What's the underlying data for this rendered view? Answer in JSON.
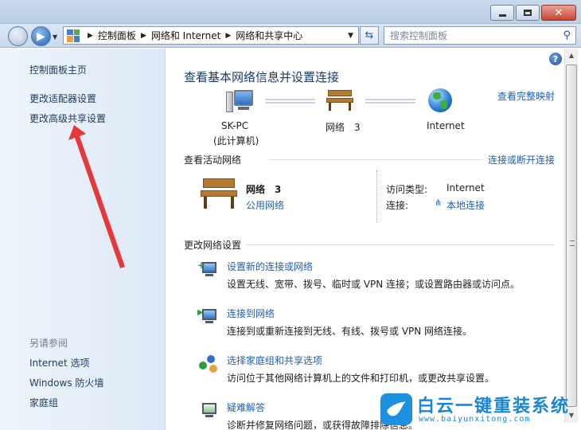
{
  "window": {
    "minimize_icon": "minimize-icon",
    "maximize_icon": "maximize-icon",
    "close_icon": "close-icon"
  },
  "nav": {
    "address": [
      "控制面板",
      "网络和 Internet",
      "网络和共享中心"
    ],
    "search_placeholder": "搜索控制面板"
  },
  "sidebar": {
    "links": [
      "控制面板主页",
      "更改适配器设置",
      "更改高级共享设置"
    ],
    "see_also_title": "另请参阅",
    "see_also": [
      "Internet 选项",
      "Windows 防火墙",
      "家庭组"
    ]
  },
  "main": {
    "title": "查看基本网络信息并设置连接",
    "full_map_link": "查看完整映射",
    "map": {
      "pc_name": "SK-PC",
      "pc_sub": "(此计算机)",
      "network_name": "网络　3",
      "internet": "Internet"
    },
    "active": {
      "section": "查看活动网络",
      "connect_link": "连接或断开连接",
      "name": "网络　3",
      "type": "公用网络",
      "access_label": "访问类型:",
      "access_value": "Internet",
      "conn_label": "连接:",
      "conn_value": "本地连接"
    },
    "change": {
      "section": "更改网络设置",
      "tasks": [
        {
          "title": "设置新的连接或网络",
          "desc": "设置无线、宽带、拨号、临时或 VPN 连接；或设置路由器或访问点。"
        },
        {
          "title": "连接到网络",
          "desc": "连接到或重新连接到无线、有线、拨号或 VPN 网络连接。"
        },
        {
          "title": "选择家庭组和共享选项",
          "desc": "访问位于其他网络计算机上的文件和打印机，或更改共享设置。"
        },
        {
          "title": "疑难解答",
          "desc": "诊断并修复网络问题，或获得故障排除信息。"
        }
      ]
    }
  },
  "watermark": {
    "title": "白云一键重装系统",
    "url": "www.baiyunxitong.com"
  },
  "colors": {
    "link": "#1f5fb5",
    "heading": "#1b3a6b",
    "sidebar_bg": "#dde9f7",
    "arrow": "#e5383b"
  }
}
